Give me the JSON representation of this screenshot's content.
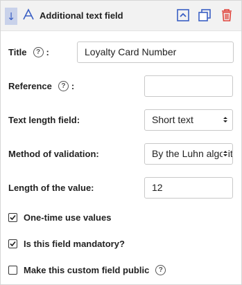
{
  "header": {
    "title": "Additional text field",
    "drag_icon": "arrow-down-icon",
    "type_icon": "text-field-icon",
    "actions": [
      "collapse-icon",
      "duplicate-icon",
      "delete-icon"
    ],
    "accent": "#3a5fc4",
    "danger": "#e0433a"
  },
  "form": {
    "title_label": "Title",
    "title_value": "Loyalty Card Number",
    "reference_label": "Reference",
    "reference_value": "",
    "text_length_label": "Text length field:",
    "text_length_value": "Short text",
    "validation_label": "Method of validation:",
    "validation_value": "By the Luhn algorithm",
    "length_label": "Length of the value:",
    "length_value": "12",
    "colon": ":"
  },
  "options": {
    "one_time_label": "One-time use values",
    "one_time_checked": true,
    "mandatory_label": "Is this field mandatory?",
    "mandatory_checked": true,
    "public_label": "Make this custom field public",
    "public_checked": false
  },
  "help_glyph": "?"
}
